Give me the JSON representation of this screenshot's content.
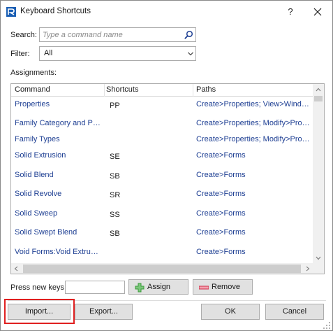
{
  "window": {
    "title": "Keyboard Shortcuts",
    "help_label": "?",
    "app_icon": "revit-logo-icon",
    "close_icon": "close-icon"
  },
  "search": {
    "label": "Search:",
    "placeholder": "Type a command name",
    "value": "",
    "icon": "search-icon"
  },
  "filter": {
    "label": "Filter:",
    "value": "All",
    "icon": "chevron-down-icon"
  },
  "assignments": {
    "label": "Assignments:",
    "columns": [
      "Command",
      "Shortcuts",
      "Paths"
    ],
    "rows": [
      {
        "command": "Properties",
        "shortcut": "PP",
        "path": "Create>Properties; View>Windo..."
      },
      {
        "command": "Family Category and Par...",
        "shortcut": "",
        "path": "Create>Properties; Modify>Prope..."
      },
      {
        "command": "Family Types",
        "shortcut": "",
        "path": "Create>Properties; Modify>Prope..."
      },
      {
        "command": "Solid Extrusion",
        "shortcut": "SE",
        "path": "Create>Forms"
      },
      {
        "command": "Solid Blend",
        "shortcut": "SB",
        "path": "Create>Forms"
      },
      {
        "command": "Solid Revolve",
        "shortcut": "SR",
        "path": "Create>Forms"
      },
      {
        "command": "Solid Sweep",
        "shortcut": "SS",
        "path": "Create>Forms"
      },
      {
        "command": "Solid Swept Blend",
        "shortcut": "SB",
        "path": "Create>Forms"
      },
      {
        "command": "Void Forms:Void Extrusion",
        "shortcut": "",
        "path": "Create>Forms"
      }
    ]
  },
  "keys": {
    "label": "Press new keys:",
    "value": "",
    "assign_label": "Assign",
    "remove_label": "Remove"
  },
  "footer": {
    "import_label": "Import...",
    "export_label": "Export...",
    "ok_label": "OK",
    "cancel_label": "Cancel"
  },
  "colors": {
    "link_text": "#1e3f93",
    "highlight_border": "#e02020",
    "button_face": "#e1e1e1",
    "assign_icon": "#3a9a3a",
    "remove_icon": "#d0304a"
  }
}
